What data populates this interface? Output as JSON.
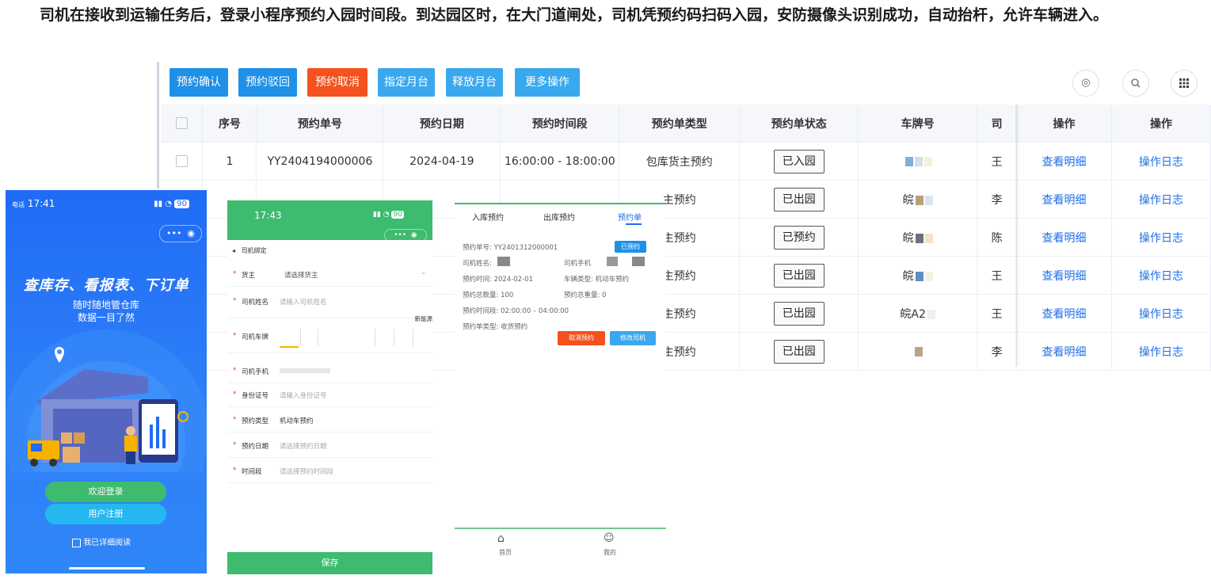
{
  "caption": "司机在接收到运输任务后，登录小程序预约入园时间段。到达园区时，在大门道闸处，司机凭预约码扫码入园，安防摄像头识别成功，自动抬杆，允许车辆进入。",
  "toolbar": {
    "buttons": [
      "预约确认",
      "预约驳回",
      "预约取消",
      "指定月台",
      "释放月台",
      "更多操作"
    ],
    "icons": [
      "eye-icon",
      "search-icon",
      "grid-icon"
    ]
  },
  "table": {
    "headers": [
      "序号",
      "预约单号",
      "预约日期",
      "预约时间段",
      "预约单类型",
      "预约单状态",
      "车牌号",
      "司",
      "操作",
      "操作"
    ],
    "rows": [
      {
        "seq": "1",
        "order_no": "YY2404194000006",
        "date": "2024-04-19",
        "time": "16:00:00 - 18:00:00",
        "type": "包库货主预约",
        "status": "已入园",
        "plate": "",
        "driver": "王",
        "op1": "查看明细",
        "op2": "操作日志"
      },
      {
        "seq": "",
        "order_no": "",
        "date": "",
        "time": "",
        "type": "主预约",
        "status": "已出园",
        "plate": "皖",
        "driver": "李",
        "op1": "查看明细",
        "op2": "操作日志"
      },
      {
        "seq": "",
        "order_no": "",
        "date": "",
        "time": "",
        "type": "主预约",
        "status": "已预约",
        "plate": "皖",
        "driver": "陈",
        "op1": "查看明细",
        "op2": "操作日志"
      },
      {
        "seq": "",
        "order_no": "",
        "date": "",
        "time": "",
        "type": "主预约",
        "status": "已出园",
        "plate": "皖",
        "driver": "王",
        "op1": "查看明细",
        "op2": "操作日志"
      },
      {
        "seq": "",
        "order_no": "",
        "date": "",
        "time": "",
        "type": "主预约",
        "status": "已出园",
        "plate": "皖A2",
        "driver": "王",
        "op1": "查看明细",
        "op2": "操作日志"
      },
      {
        "seq": "",
        "order_no": "",
        "date": "",
        "time": "",
        "type": "主预约",
        "status": "已出园",
        "plate": "",
        "driver": "李",
        "op1": "查看明细",
        "op2": "操作日志"
      }
    ]
  },
  "phone1": {
    "time": "17:41",
    "carrier": "电话",
    "battery": "90",
    "headline": "查库存、看报表、下订单",
    "sub1": "随时随地管仓库",
    "sub2": "数据一目了然",
    "login": "欢迎登录",
    "register": "用户注册",
    "agree": "我已详细阅读"
  },
  "phone2": {
    "time": "17:43",
    "battery": "90",
    "nav_title": "司机绑定",
    "fields": [
      {
        "label": "货主",
        "value": "请选择货主",
        "filled": false
      },
      {
        "label": "司机姓名",
        "value": "请输入司机姓名",
        "filled": false
      },
      {
        "label": "司机车牌",
        "value": "",
        "filled": false
      },
      {
        "label": "司机手机",
        "value": "",
        "filled": true
      },
      {
        "label": "身份证号",
        "value": "请输入身份证号",
        "filled": false
      },
      {
        "label": "预约类型",
        "value": "机动车预约",
        "filled": true
      },
      {
        "label": "预约日期",
        "value": "请选择预约日期",
        "filled": false
      },
      {
        "label": "时间段",
        "value": "请选择预约时间段",
        "filled": false
      }
    ],
    "new_energy": "新能源",
    "save": "保存"
  },
  "phone3": {
    "tabs": [
      "入库预约",
      "出库预约",
      "预约单"
    ],
    "order_label": "预约单号:",
    "order_no": "YY2401312000001",
    "status_badge": "已预约",
    "driver_name_label": "司机姓名:",
    "driver_phone_label": "司机手机",
    "time_label": "预约时间:",
    "time_value": "2024-02-01",
    "vehicle_label": "车辆类型:",
    "vehicle_value": "机动车预约",
    "qty_label": "预约总数量:",
    "qty_value": "100",
    "weight_label": "预约总重量:",
    "weight_value": "0",
    "slot_label": "预约时间段:",
    "slot_value": "02:00:00 – 04:00:00",
    "type_label": "预约单类型:",
    "type_value": "收货预约",
    "cancel": "取消预约",
    "modify": "修改司机",
    "nav": [
      "首页",
      "我的"
    ]
  },
  "colors": {
    "primary_blue": "#1e90e8",
    "danger_red": "#f4511e",
    "mini_green": "#3dbb6e",
    "link_blue": "#1e6fe8"
  }
}
